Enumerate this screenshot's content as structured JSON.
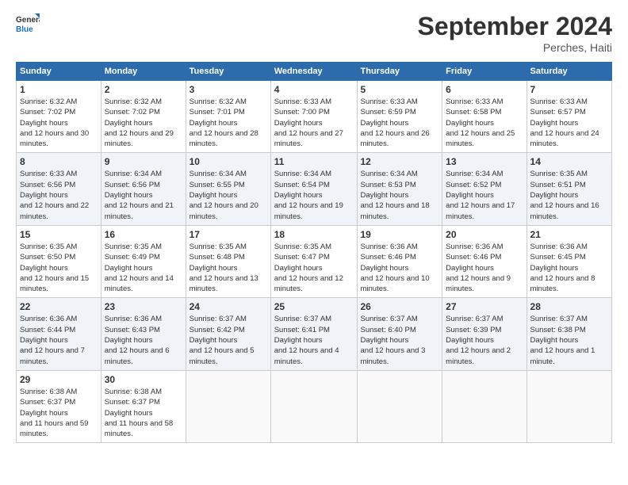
{
  "header": {
    "logo_line1": "General",
    "logo_line2": "Blue",
    "month_title": "September 2024",
    "location": "Perches, Haiti"
  },
  "days_of_week": [
    "Sunday",
    "Monday",
    "Tuesday",
    "Wednesday",
    "Thursday",
    "Friday",
    "Saturday"
  ],
  "weeks": [
    [
      {
        "num": "1",
        "sunrise": "6:32 AM",
        "sunset": "7:02 PM",
        "daylight": "12 hours and 30 minutes."
      },
      {
        "num": "2",
        "sunrise": "6:32 AM",
        "sunset": "7:02 PM",
        "daylight": "12 hours and 29 minutes."
      },
      {
        "num": "3",
        "sunrise": "6:32 AM",
        "sunset": "7:01 PM",
        "daylight": "12 hours and 28 minutes."
      },
      {
        "num": "4",
        "sunrise": "6:33 AM",
        "sunset": "7:00 PM",
        "daylight": "12 hours and 27 minutes."
      },
      {
        "num": "5",
        "sunrise": "6:33 AM",
        "sunset": "6:59 PM",
        "daylight": "12 hours and 26 minutes."
      },
      {
        "num": "6",
        "sunrise": "6:33 AM",
        "sunset": "6:58 PM",
        "daylight": "12 hours and 25 minutes."
      },
      {
        "num": "7",
        "sunrise": "6:33 AM",
        "sunset": "6:57 PM",
        "daylight": "12 hours and 24 minutes."
      }
    ],
    [
      {
        "num": "8",
        "sunrise": "6:33 AM",
        "sunset": "6:56 PM",
        "daylight": "12 hours and 22 minutes."
      },
      {
        "num": "9",
        "sunrise": "6:34 AM",
        "sunset": "6:56 PM",
        "daylight": "12 hours and 21 minutes."
      },
      {
        "num": "10",
        "sunrise": "6:34 AM",
        "sunset": "6:55 PM",
        "daylight": "12 hours and 20 minutes."
      },
      {
        "num": "11",
        "sunrise": "6:34 AM",
        "sunset": "6:54 PM",
        "daylight": "12 hours and 19 minutes."
      },
      {
        "num": "12",
        "sunrise": "6:34 AM",
        "sunset": "6:53 PM",
        "daylight": "12 hours and 18 minutes."
      },
      {
        "num": "13",
        "sunrise": "6:34 AM",
        "sunset": "6:52 PM",
        "daylight": "12 hours and 17 minutes."
      },
      {
        "num": "14",
        "sunrise": "6:35 AM",
        "sunset": "6:51 PM",
        "daylight": "12 hours and 16 minutes."
      }
    ],
    [
      {
        "num": "15",
        "sunrise": "6:35 AM",
        "sunset": "6:50 PM",
        "daylight": "12 hours and 15 minutes."
      },
      {
        "num": "16",
        "sunrise": "6:35 AM",
        "sunset": "6:49 PM",
        "daylight": "12 hours and 14 minutes."
      },
      {
        "num": "17",
        "sunrise": "6:35 AM",
        "sunset": "6:48 PM",
        "daylight": "12 hours and 13 minutes."
      },
      {
        "num": "18",
        "sunrise": "6:35 AM",
        "sunset": "6:47 PM",
        "daylight": "12 hours and 12 minutes."
      },
      {
        "num": "19",
        "sunrise": "6:36 AM",
        "sunset": "6:46 PM",
        "daylight": "12 hours and 10 minutes."
      },
      {
        "num": "20",
        "sunrise": "6:36 AM",
        "sunset": "6:46 PM",
        "daylight": "12 hours and 9 minutes."
      },
      {
        "num": "21",
        "sunrise": "6:36 AM",
        "sunset": "6:45 PM",
        "daylight": "12 hours and 8 minutes."
      }
    ],
    [
      {
        "num": "22",
        "sunrise": "6:36 AM",
        "sunset": "6:44 PM",
        "daylight": "12 hours and 7 minutes."
      },
      {
        "num": "23",
        "sunrise": "6:36 AM",
        "sunset": "6:43 PM",
        "daylight": "12 hours and 6 minutes."
      },
      {
        "num": "24",
        "sunrise": "6:37 AM",
        "sunset": "6:42 PM",
        "daylight": "12 hours and 5 minutes."
      },
      {
        "num": "25",
        "sunrise": "6:37 AM",
        "sunset": "6:41 PM",
        "daylight": "12 hours and 4 minutes."
      },
      {
        "num": "26",
        "sunrise": "6:37 AM",
        "sunset": "6:40 PM",
        "daylight": "12 hours and 3 minutes."
      },
      {
        "num": "27",
        "sunrise": "6:37 AM",
        "sunset": "6:39 PM",
        "daylight": "12 hours and 2 minutes."
      },
      {
        "num": "28",
        "sunrise": "6:37 AM",
        "sunset": "6:38 PM",
        "daylight": "12 hours and 1 minute."
      }
    ],
    [
      {
        "num": "29",
        "sunrise": "6:38 AM",
        "sunset": "6:37 PM",
        "daylight": "11 hours and 59 minutes."
      },
      {
        "num": "30",
        "sunrise": "6:38 AM",
        "sunset": "6:37 PM",
        "daylight": "11 hours and 58 minutes."
      },
      null,
      null,
      null,
      null,
      null
    ]
  ]
}
